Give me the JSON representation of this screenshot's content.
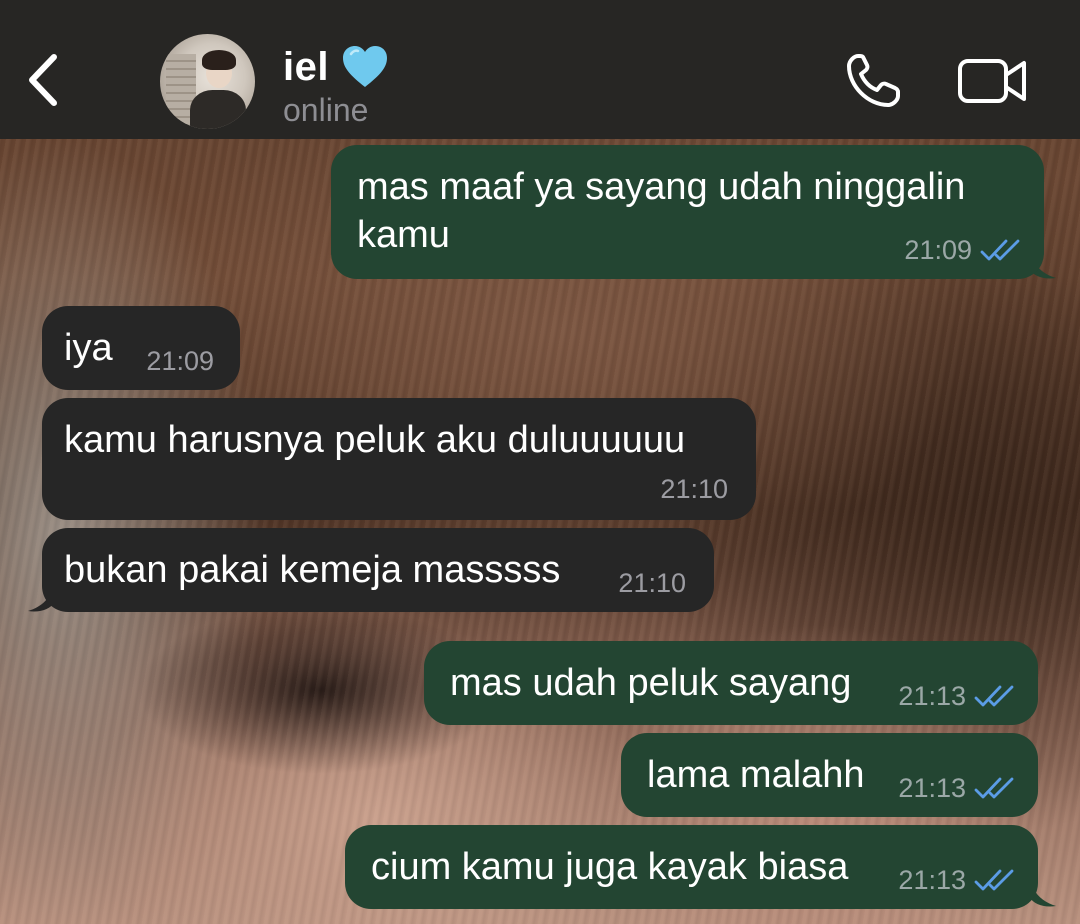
{
  "header": {
    "contact_name": "iel",
    "name_emoji_icon": "light-blue-heart-icon",
    "status": "online",
    "back_icon": "chevron-left-icon",
    "call_icon": "phone-icon",
    "video_icon": "video-camera-icon"
  },
  "colors": {
    "header_bg": "#272624",
    "outgoing_bubble": "#234532",
    "incoming_bubble": "#262626",
    "read_ticks": "#5b9ce6",
    "heart": "#6fc9ee"
  },
  "messages": [
    {
      "direction": "outgoing",
      "text": "mas maaf ya sayang udah ninggalin kamu",
      "time": "21:09",
      "status": "read"
    },
    {
      "direction": "incoming",
      "text": "iya",
      "time": "21:09"
    },
    {
      "direction": "incoming",
      "text": "kamu harusnya peluk aku duluuuuuu",
      "time": "21:10"
    },
    {
      "direction": "incoming",
      "text": "bukan pakai kemeja masssss",
      "time": "21:10"
    },
    {
      "direction": "outgoing",
      "text": "mas udah peluk sayang",
      "time": "21:13",
      "status": "read"
    },
    {
      "direction": "outgoing",
      "text": "lama malahh",
      "time": "21:13",
      "status": "read"
    },
    {
      "direction": "outgoing",
      "text": "cium kamu juga kayak biasa",
      "time": "21:13",
      "status": "read"
    }
  ]
}
